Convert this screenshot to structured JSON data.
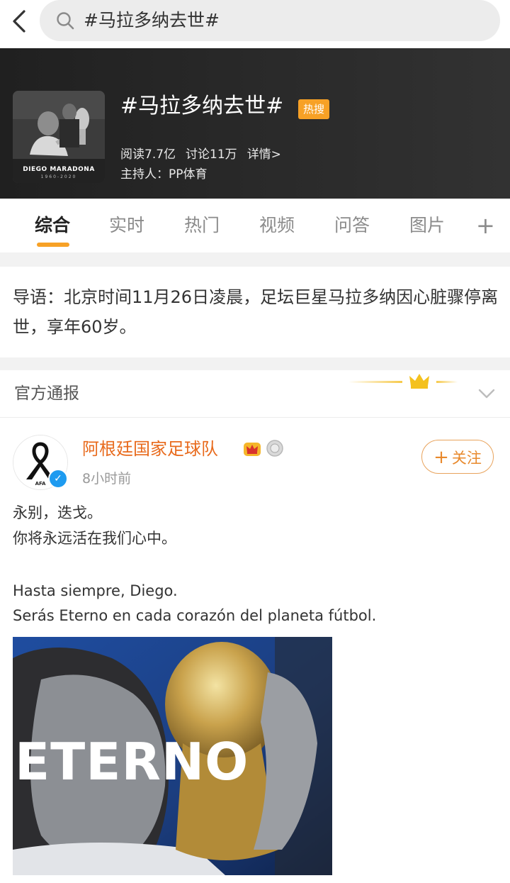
{
  "search": {
    "query": "#马拉多纳去世#"
  },
  "topic": {
    "title": "#马拉多纳去世#",
    "badge": "热搜",
    "reads": "阅读7.7亿",
    "discussions": "讨论11万",
    "details_link": "详情>",
    "host": "主持人：PP体育",
    "cover_caption": "DIEGO MARADONA",
    "cover_years": "1960-2020"
  },
  "tabs": [
    {
      "label": "综合",
      "active": true
    },
    {
      "label": "实时",
      "active": false
    },
    {
      "label": "热门",
      "active": false
    },
    {
      "label": "视频",
      "active": false
    },
    {
      "label": "问答",
      "active": false
    },
    {
      "label": "图片",
      "active": false
    }
  ],
  "tab_add": "+",
  "intro": {
    "text": "导语：北京时间11月26日凌晨，足坛巨星马拉多纳因心脏骤停离世，享年60岁。"
  },
  "official_section": {
    "title": "官方通报"
  },
  "post": {
    "author": "阿根廷国家足球队",
    "time": "8小时前",
    "follow_label": "关注",
    "lines": [
      "永别，迭戈。",
      "你将永远活在我们心中。",
      "",
      "Hasta siempre, Diego.",
      "Serás Eterno en cada corazón del planeta fútbol."
    ],
    "image_text": "ETERNO"
  },
  "colors": {
    "accent_orange": "#f7a126",
    "author_orange": "#e86a1c",
    "verified_blue": "#1e9bf0",
    "banner_dark": "#2a2a2a"
  },
  "icons": [
    "back-arrow-icon",
    "search-icon",
    "plus-icon",
    "chevron-down-icon",
    "crown-icon",
    "medal-icon",
    "verified-icon",
    "mourning-ribbon-icon"
  ]
}
